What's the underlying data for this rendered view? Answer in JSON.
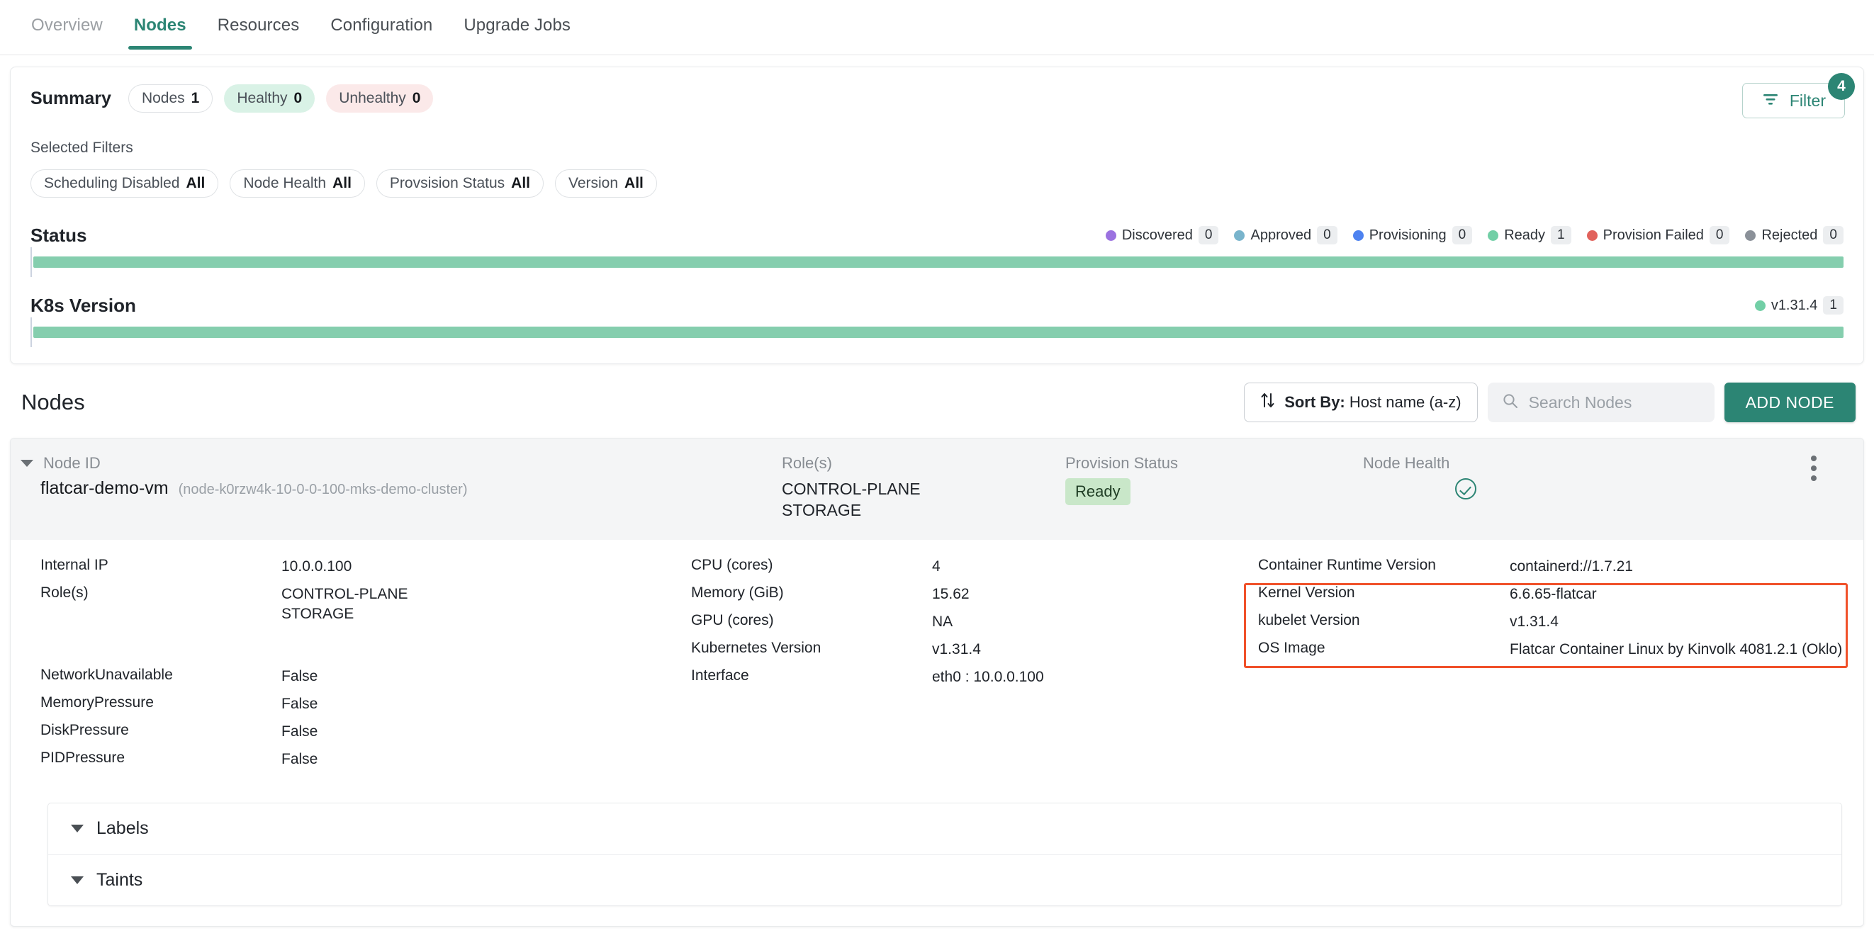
{
  "tabs": [
    {
      "label": "Overview",
      "active": false,
      "muted": true
    },
    {
      "label": "Nodes",
      "active": true,
      "muted": false
    },
    {
      "label": "Resources",
      "active": false,
      "muted": false
    },
    {
      "label": "Configuration",
      "active": false,
      "muted": false
    },
    {
      "label": "Upgrade Jobs",
      "active": false,
      "muted": false
    }
  ],
  "summary": {
    "title": "Summary",
    "chips": [
      {
        "label": "Nodes",
        "value": "1",
        "style": "outline"
      },
      {
        "label": "Healthy",
        "value": "0",
        "style": "green"
      },
      {
        "label": "Unhealthy",
        "value": "0",
        "style": "red"
      }
    ],
    "filter_button": {
      "label": "Filter",
      "badge": "4",
      "icon": "filter-icon"
    },
    "selected_filters_label": "Selected Filters",
    "selected_filters": [
      {
        "label": "Scheduling Disabled",
        "value": "All"
      },
      {
        "label": "Node Health",
        "value": "All"
      },
      {
        "label": "Provsision Status",
        "value": "All"
      },
      {
        "label": "Version",
        "value": "All"
      }
    ]
  },
  "chart_data": [
    {
      "type": "bar",
      "title": "Status",
      "orientation": "horizontal-stacked",
      "categories": [
        "Discovered",
        "Approved",
        "Provisioning",
        "Ready",
        "Provision Failed",
        "Rejected"
      ],
      "values": [
        0,
        0,
        0,
        1,
        0,
        0
      ],
      "colors": [
        "#9b72e0",
        "#79b4cc",
        "#4d82f0",
        "#72cfa6",
        "#e1625c",
        "#8b9199"
      ],
      "total": 1,
      "legend_position": "top-right",
      "grid": false,
      "bar_color": "#85ceae"
    },
    {
      "type": "bar",
      "title": "K8s Version",
      "orientation": "horizontal-stacked",
      "categories": [
        "v1.31.4"
      ],
      "values": [
        1
      ],
      "colors": [
        "#72cfa6"
      ],
      "total": 1,
      "legend_position": "top-right",
      "grid": false,
      "bar_color": "#85ceae"
    }
  ],
  "nodes_section": {
    "title": "Nodes",
    "sort": {
      "prefix": "Sort By:",
      "value": "Host name (a-z)",
      "icon": "sort-icon"
    },
    "search": {
      "placeholder": "Search Nodes",
      "value": "",
      "icon": "search-icon"
    },
    "add_button": "ADD NODE"
  },
  "node": {
    "headers": {
      "node_id": "Node ID",
      "roles": "Role(s)",
      "provision_status": "Provision Status",
      "node_health": "Node Health"
    },
    "name": "flatcar-demo-vm",
    "id": "(node-k0rzw4k-10-0-0-100-mks-demo-cluster)",
    "roles": [
      "CONTROL-PLANE",
      "STORAGE"
    ],
    "provision_status": "Ready",
    "health_icon": "check-circle-icon",
    "menu_icon": "kebab-menu-icon",
    "details_col1": [
      {
        "key": "Internal IP",
        "value": "10.0.0.100"
      },
      {
        "key": "Role(s)",
        "value": "CONTROL-PLANE",
        "value2": "STORAGE"
      },
      {
        "key": "NetworkUnavailable",
        "value": "False"
      },
      {
        "key": "MemoryPressure",
        "value": "False"
      },
      {
        "key": "DiskPressure",
        "value": "False"
      },
      {
        "key": "PIDPressure",
        "value": "False"
      }
    ],
    "details_col2": [
      {
        "key": "CPU (cores)",
        "value": "4"
      },
      {
        "key": "Memory (GiB)",
        "value": "15.62"
      },
      {
        "key": "GPU (cores)",
        "value": "NA"
      },
      {
        "key": "Kubernetes Version",
        "value": "v1.31.4"
      },
      {
        "key": "Interface",
        "value": "eth0 : 10.0.0.100"
      }
    ],
    "details_col3": [
      {
        "key": "Container Runtime Version",
        "value": "containerd://1.7.21"
      },
      {
        "key": "Kernel Version",
        "value": "6.6.65-flatcar"
      },
      {
        "key": "kubelet Version",
        "value": "v1.31.4"
      },
      {
        "key": "OS Image",
        "value": "Flatcar Container Linux by Kinvolk 4081.2.1 (Oklo)"
      }
    ],
    "highlight_color": "#f0512a",
    "expanders": [
      {
        "label": "Labels"
      },
      {
        "label": "Taints"
      }
    ]
  },
  "colors": {
    "accent": "#2c8574",
    "bar_green": "#85ceae",
    "ready_pill": "#c9e7c9",
    "highlight": "#f0512a"
  }
}
